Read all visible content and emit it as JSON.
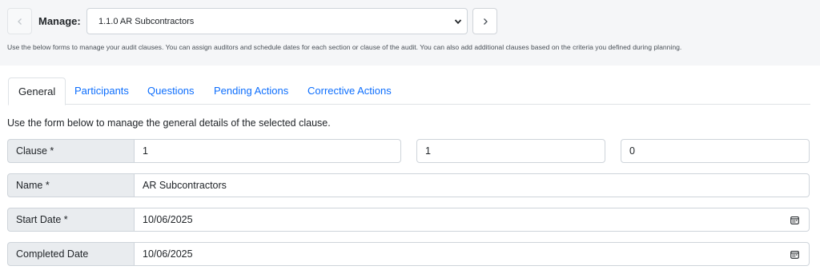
{
  "header": {
    "manage_label": "Manage:",
    "selected_clause": "1.1.0 AR Subcontractors",
    "help_text": "Use the below forms to manage your audit clauses. You can assign auditors and schedule dates for each section or clause of the audit. You can also add additional clauses based on the criteria you defined during planning."
  },
  "tabs": [
    {
      "label": "General",
      "active": true
    },
    {
      "label": "Participants",
      "active": false
    },
    {
      "label": "Questions",
      "active": false
    },
    {
      "label": "Pending Actions",
      "active": false
    },
    {
      "label": "Corrective Actions",
      "active": false
    }
  ],
  "form": {
    "intro": "Use the form below to manage the general details of the selected clause.",
    "clause": {
      "label": "Clause *",
      "part1": "1",
      "part2": "1",
      "part3": "0"
    },
    "name": {
      "label": "Name *",
      "value": "AR Subcontractors"
    },
    "start_date": {
      "label": "Start Date *",
      "value": "10/06/2025"
    },
    "completed_date": {
      "label": "Completed Date",
      "value": "10/06/2025"
    }
  },
  "icons": {
    "prev": "chevron-left-icon",
    "next": "chevron-right-icon",
    "dropdown": "chevron-down-icon",
    "calendar": "calendar-icon"
  },
  "colors": {
    "link": "#0d6efd",
    "band": "#f5f6f8",
    "label_bg": "#e9ecef"
  }
}
